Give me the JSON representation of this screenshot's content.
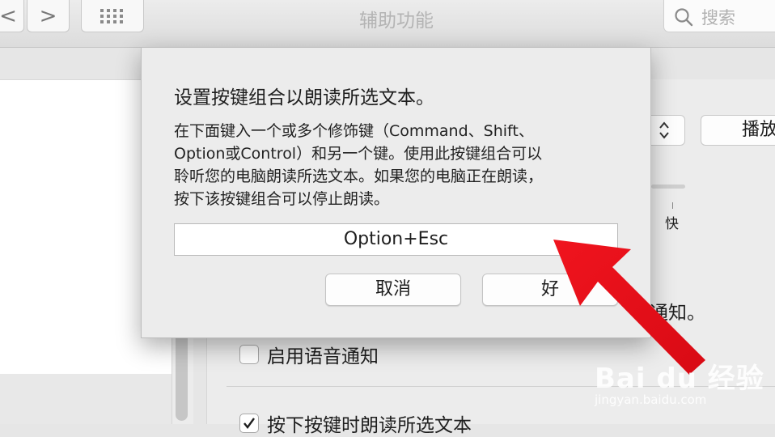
{
  "window": {
    "title": "辅助功能"
  },
  "toolbar": {
    "back_glyph": "<",
    "forward_glyph": ">"
  },
  "search": {
    "placeholder": "搜索"
  },
  "background": {
    "play_label": "播放",
    "speed_fast_label": "快",
    "notification_suffix": "通知。",
    "enable_voice_label": "启用语音通知",
    "speak_selected_label": "按下按键时朗读所选文本",
    "speak_selected_checked": true,
    "enable_voice_checked": false
  },
  "dialog": {
    "title": "设置按键组合以朗读所选文本。",
    "body_lines": [
      "在下面键入一个或多个修饰键（Command、Shift、",
      "Option或Control）和另一个键。使用此按键组合可以",
      "聆听您的电脑朗读所选文本。如果您的电脑正在朗读，",
      "按下该按键组合可以停止朗读。"
    ],
    "key_combo": "Option+Esc",
    "cancel_label": "取消",
    "ok_label": "好"
  },
  "watermark": {
    "logo": "Bai du 经验",
    "url": "jingyan.baidu.com"
  },
  "colors": {
    "annotation_arrow": "#f0141e"
  }
}
